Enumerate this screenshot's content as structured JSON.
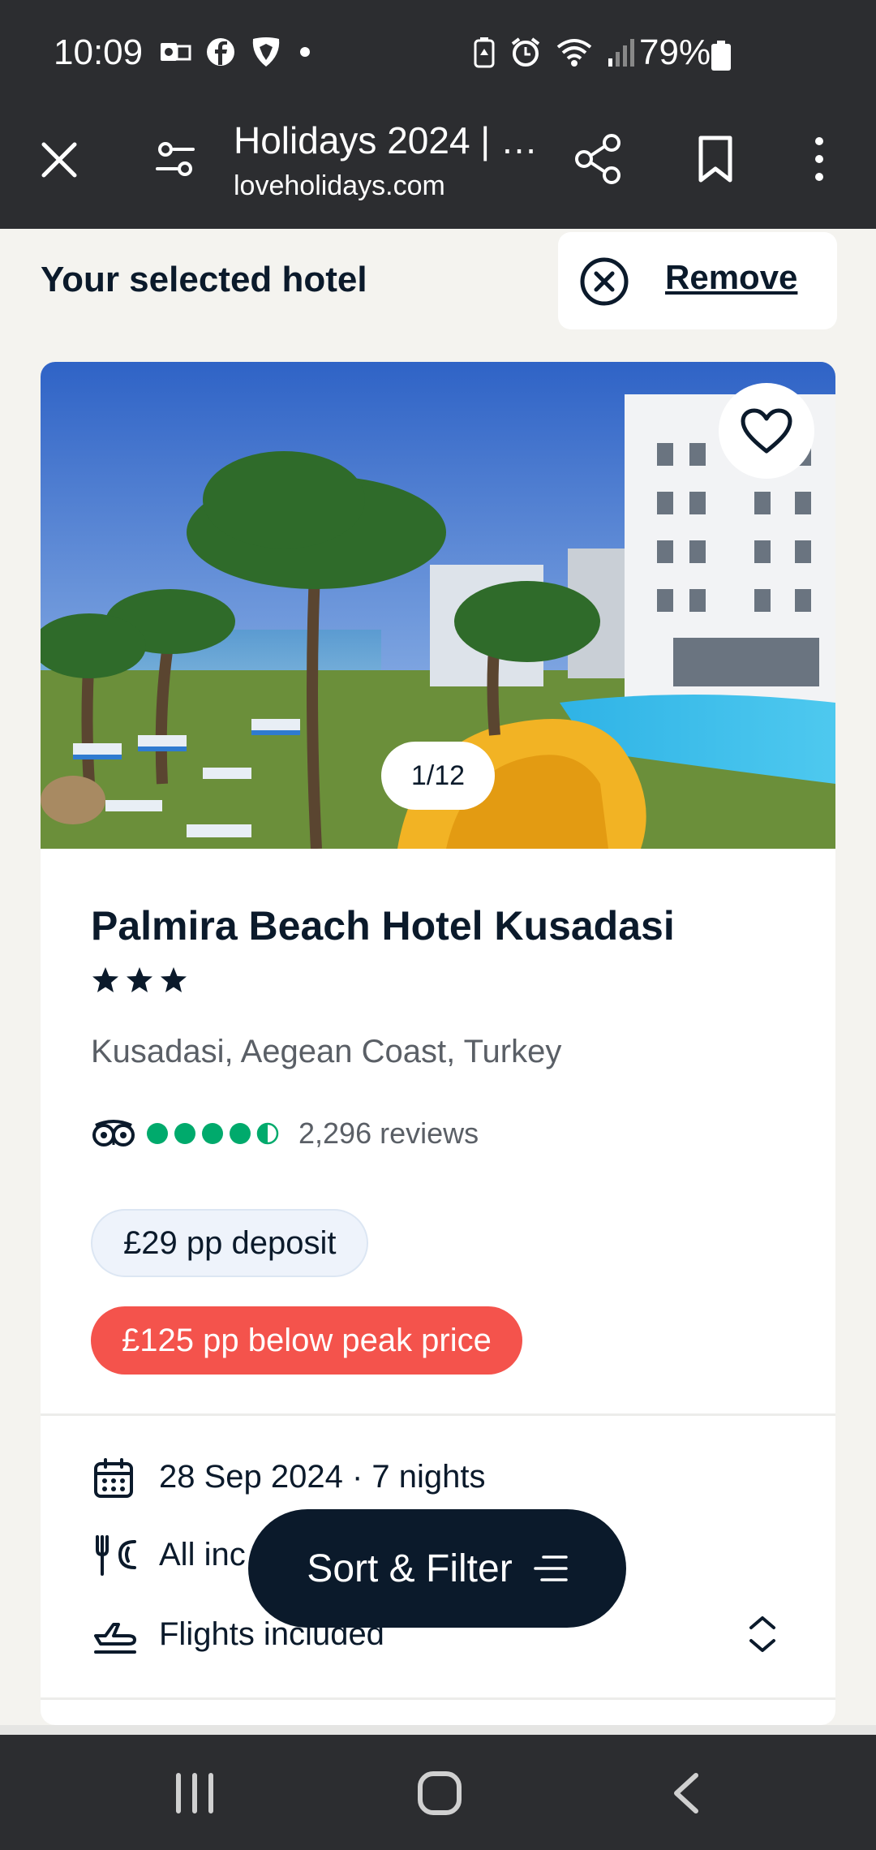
{
  "status_bar": {
    "time": "10:09",
    "battery": "79%",
    "notification_icons": [
      "outlook-icon",
      "facebook-icon",
      "barclays-icon",
      "dot-icon"
    ],
    "system_icons": [
      "battery-saver-icon",
      "alarm-icon",
      "wifi-icon",
      "signal-icon",
      "battery-icon"
    ]
  },
  "browser": {
    "title": "Holidays 2024 | …",
    "url": "loveholidays.com",
    "icons": [
      "close-icon",
      "site-settings-icon",
      "share-icon",
      "bookmark-icon",
      "more-icon"
    ]
  },
  "page": {
    "section_heading": "Your selected hotel",
    "remove_label": "Remove"
  },
  "hotel": {
    "name": "Palmira Beach Hotel Kusadasi",
    "stars": 3,
    "location": "Kusadasi, Aegean Coast, Turkey",
    "rating_bubbles": 4.5,
    "reviews": "2,296 reviews",
    "photo_counter": "1/12",
    "deposit": "£29 pp deposit",
    "peak_saving": "£125 pp below peak price",
    "date_nights": "28 Sep 2024 · 7 nights",
    "board": "All inc",
    "flights": "Flights included"
  },
  "sort_filter": {
    "label": "Sort & Filter"
  },
  "colors": {
    "primary_dark": "#0b1a2b",
    "accent_red": "#f4534c",
    "tripadvisor_green": "#00aa6c",
    "deposit_bg": "#eef3fb"
  }
}
